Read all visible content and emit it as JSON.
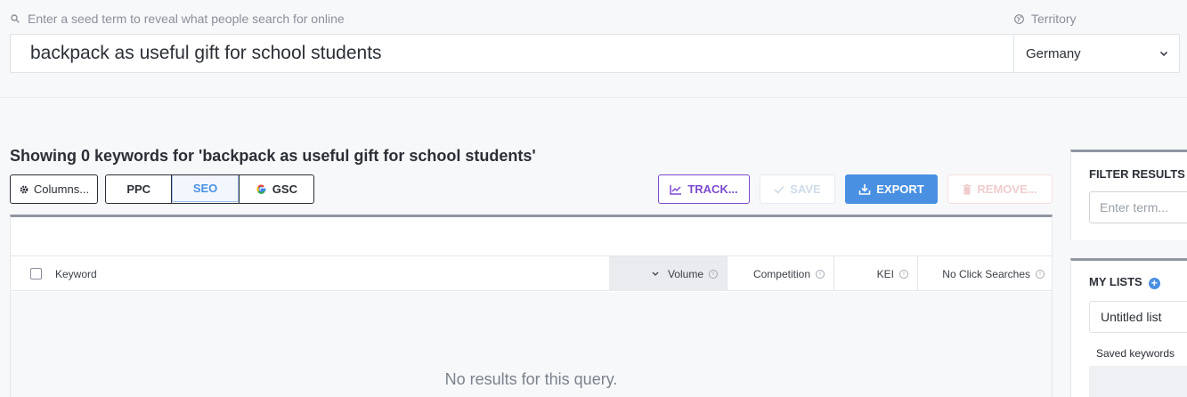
{
  "search": {
    "placeholder_label": "Enter a seed term to reveal what people search for online",
    "value": "backpack as useful gift for school students",
    "icon": "search-icon"
  },
  "territory": {
    "label": "Territory",
    "selected": "Germany",
    "icon": "globe-icon"
  },
  "results": {
    "heading": "Showing 0 keywords for 'backpack as useful gift for school students'",
    "empty_message": "No results for this query."
  },
  "toolbar": {
    "columns_label": "Columns...",
    "modes": [
      "PPC",
      "SEO",
      "GSC"
    ],
    "active_mode": "SEO",
    "track_label": "TRACK...",
    "save_label": "SAVE",
    "export_label": "EXPORT",
    "remove_label": "REMOVE..."
  },
  "table": {
    "columns": {
      "keyword": "Keyword",
      "volume": "Volume",
      "competition": "Competition",
      "kei": "KEI",
      "no_click": "No Click Searches"
    },
    "sorted_by": "Volume"
  },
  "sidebar": {
    "filter_title": "FILTER RESULTS BY",
    "filter_placeholder": "Enter term...",
    "lists_title": "MY LISTS",
    "list_selected": "Untitled list",
    "saved_keywords_label": "Saved keywords"
  },
  "colors": {
    "accent": "#4a90e2",
    "track": "#7b4bd0",
    "remove_disabled": "#f0cccc"
  }
}
